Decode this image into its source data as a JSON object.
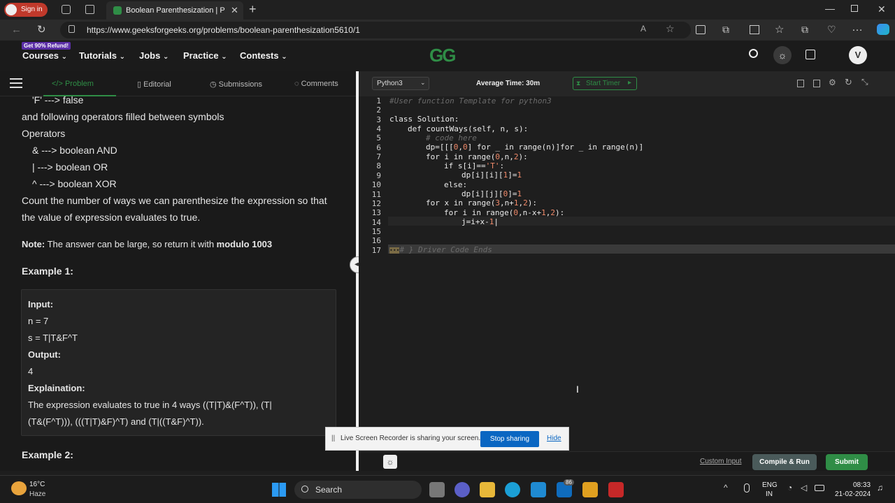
{
  "browser": {
    "tab_title": "Boolean Parenthesization | Practi",
    "url": "https://www.geeksforgeeks.org/problems/boolean-parenthesization5610/1",
    "profile_label": "Sign in"
  },
  "header": {
    "promo_badge": "Get 90% Refund!",
    "nav": [
      "Courses",
      "Tutorials",
      "Jobs",
      "Practice",
      "Contests"
    ],
    "logo": "GG",
    "avatar_letter": "V"
  },
  "problem": {
    "tabs": [
      "Problem",
      "Editorial",
      "Submissions",
      "Comments"
    ],
    "lines": [
      "'F' ---> false",
      "and following operators filled between symbols",
      "Operators",
      "&   ---> boolean AND",
      "|   ---> boolean OR",
      "^   ---> boolean XOR",
      "Count the number of ways we can parenthesize the expression so that",
      "the value of expression evaluates to true."
    ],
    "note_label": "Note:",
    "note_text": " The answer can be large, so return it with ",
    "note_bold": "modulo 1003",
    "example1_title": "Example 1:",
    "input_label": "Input:",
    "input_n": "n = 7",
    "input_s": "s = T|T&F^T",
    "output_label": "Output:",
    "output_value": "4",
    "explain_label": "Explaination:",
    "explain_line1": "The expression evaluates to true in 4 ways ((T|T)&(F^T)), (T|",
    "explain_line2": "(T&(F^T))), (((T|T)&F)^T) and (T|((T&F)^T)).",
    "example2_title": "Example 2:"
  },
  "editor": {
    "language": "Python3",
    "avg_time": "Average Time: 30m",
    "timer_label": "Start Timer",
    "line_numbers": [
      "1",
      "2",
      "3",
      "4",
      "5",
      "6",
      "7",
      "8",
      "9",
      "10",
      "11",
      "12",
      "13",
      "14",
      "15",
      "16",
      "17"
    ],
    "fold_marker": "•••",
    "driver_comment": "# } Driver Code Ends",
    "custom_input": "Custom Input",
    "compile_run": "Compile & Run",
    "submit": "Submit"
  },
  "share": {
    "message": "Live Screen Recorder is sharing your screen.",
    "stop_label": "Stop sharing",
    "hide_label": "Hide"
  },
  "taskbar": {
    "weather_temp": "16°C",
    "weather_desc": "Haze",
    "search_label": "Search",
    "badge_count": "86",
    "lang_top": "ENG",
    "lang_bottom": "IN",
    "time": "08:33",
    "date": "21-02-2024"
  },
  "colors": {
    "gfg_green": "#2f8d46",
    "submit_green": "#2f8d46",
    "stop_blue": "#0a66c2"
  }
}
